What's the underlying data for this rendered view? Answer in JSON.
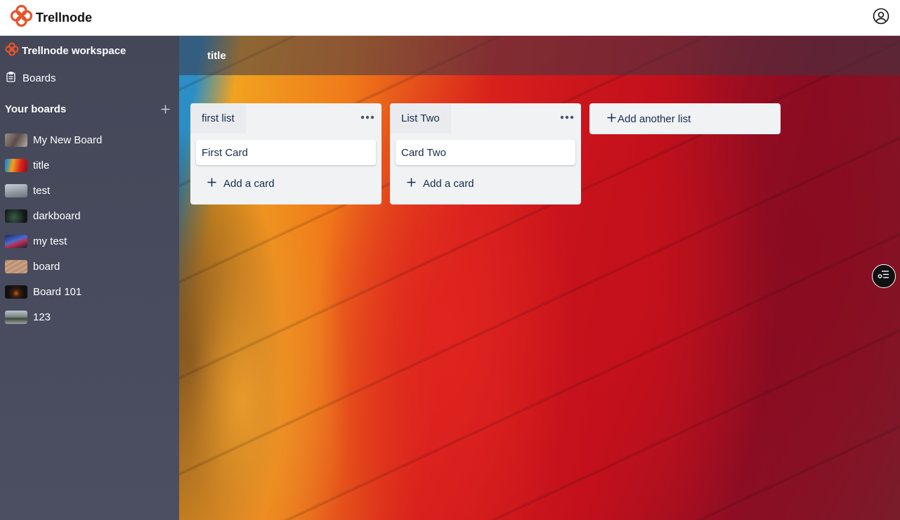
{
  "app": {
    "name": "Trellnode"
  },
  "header": {
    "user_icon": "user-circle-icon"
  },
  "sidebar": {
    "workspace_name": "Trellnode workspace",
    "boards_link": "Boards",
    "your_boards_label": "Your boards",
    "boards": [
      {
        "name": "My New Board"
      },
      {
        "name": "title"
      },
      {
        "name": "test"
      },
      {
        "name": "darkboard"
      },
      {
        "name": "my test"
      },
      {
        "name": "board"
      },
      {
        "name": "Board 101"
      },
      {
        "name": "123"
      }
    ]
  },
  "board": {
    "title": "title",
    "lists": [
      {
        "title": "first list",
        "cards": [
          {
            "text": "First Card"
          }
        ],
        "add_card": "Add a card"
      },
      {
        "title": "List Two",
        "cards": [
          {
            "text": "Card Two"
          }
        ],
        "add_card": "Add a card"
      }
    ],
    "add_list": "Add another list"
  },
  "colors": {
    "brand": "#e8542a",
    "sidebar": "#454859"
  }
}
